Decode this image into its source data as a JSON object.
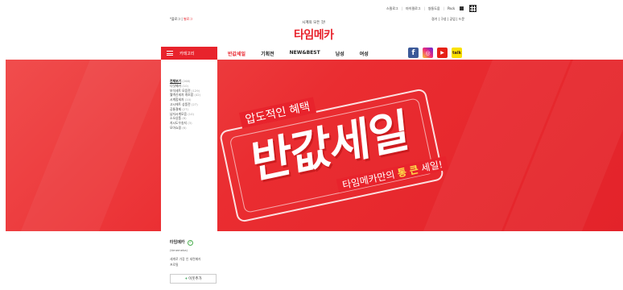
{
  "top_links": [
    "스필로그",
    "마이필로그",
    "쌍둥도움",
    "Pack"
  ],
  "top_left": {
    "login": "*플로그",
    "join": "별로그"
  },
  "top_right": "경기 | 구성 | 공업 | 드문",
  "logo": {
    "tagline": "시계의 모든 것!",
    "name": "타임메카"
  },
  "nav": {
    "category_label": "카테고리",
    "menu": [
      "반값세일",
      "기획전",
      "NEW&BEST",
      "남성",
      "여성"
    ]
  },
  "social": [
    {
      "icon": "facebook-icon",
      "glyph": "f",
      "color": "#3b5998"
    },
    {
      "icon": "instagram-icon",
      "glyph": "◎",
      "color": "#ee2a7b"
    },
    {
      "icon": "youtube-icon",
      "glyph": "▶",
      "color": "#e62117"
    },
    {
      "icon": "kakao-icon",
      "glyph": "talk",
      "color": "#fae100"
    }
  ],
  "categories": {
    "header": "전체보기",
    "header_count": "(268)",
    "items": [
      {
        "label": "다섯메카",
        "count": "(10)"
      },
      {
        "label": "보석세트 모음전",
        "count": "(129)"
      },
      {
        "label": "월액신세자 개조합",
        "count": "(42)"
      },
      {
        "label": "시계합세자",
        "count": "(10)"
      },
      {
        "label": "고시에트 상품전",
        "count": "(27)"
      },
      {
        "label": "공통결제",
        "count": "(27)"
      },
      {
        "label": "남자시계모음",
        "count": "(10)"
      },
      {
        "label": "소오상품",
        "count": "(8)"
      },
      {
        "label": "지시도우송지",
        "count": "(3)"
      },
      {
        "label": "모아쇼핑",
        "count": "(6)"
      }
    ]
  },
  "banner": {
    "small_text": "압도적인 혜택",
    "big_text": "반값세일",
    "bottom_prefix": "타임메카만의",
    "bottom_highlight": "통 큰",
    "bottom_suffix": "세일!"
  },
  "profile": {
    "name": "타임메카",
    "handle": "(timemeka)",
    "desc_line1": "세계로 가장 인 세련메카",
    "desc_line2": "프로필",
    "friend_button": "이웃추가"
  },
  "colors": {
    "accent": "#e8232c"
  }
}
